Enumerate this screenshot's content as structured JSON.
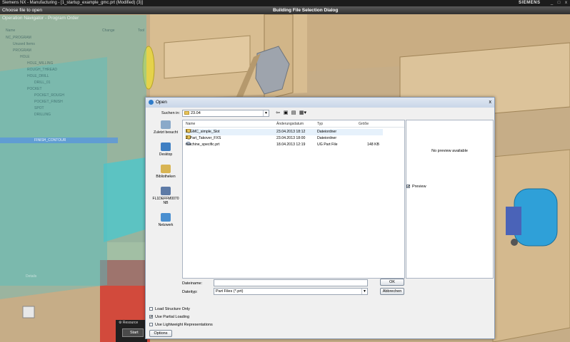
{
  "window": {
    "title": "Siemens NX - Manufacturing - [1_startup_example_gmc.prt (Modified)   (3)]",
    "brand": "SIEMENS",
    "controls": [
      "_",
      "□",
      "x"
    ]
  },
  "command_bar": {
    "prompt": "Choose file to open",
    "dialog_name": "Building File Selection Dialog"
  },
  "navigator": {
    "title": "Operation Navigator - Program Order",
    "columns": [
      "Name",
      "Change",
      "Tool"
    ],
    "rows": [
      "NC_PROGRAM",
      "Unused Items",
      "PROGRAM",
      "HOLE",
      "HOLE_MILLING",
      "ROUGH_THREAD",
      "HOLE_DRILL",
      "DRILL_01",
      "POCKET",
      "POCKET_ROUGH",
      "POCKET_FINISH",
      "SPOT",
      "DRILLING",
      "FINISH_CONTOUR"
    ],
    "selected_index": 13,
    "footer": "Details"
  },
  "resource_bar": {
    "label": "Resource",
    "start": "Start"
  },
  "dialog": {
    "title": "Open",
    "close": "x",
    "look_in_label": "Suchen in:",
    "look_in_value": "23.04",
    "places": [
      {
        "label": "Zuletzt besucht",
        "icon": "recent-places-icon",
        "color": "#8aa9c9"
      },
      {
        "label": "Desktop",
        "icon": "desktop-icon",
        "color": "#3f7fc3"
      },
      {
        "label": "Bibliotheken",
        "icon": "libraries-icon",
        "color": "#d8b453"
      },
      {
        "label": "FL1DEFFM0070 NB",
        "icon": "computer-icon",
        "color": "#5d7aa6"
      },
      {
        "label": "Netzwerk",
        "icon": "network-icon",
        "color": "#4a8fd0"
      }
    ],
    "columns": [
      "Name",
      "Änderungsdatum",
      "Typ",
      "Größe"
    ],
    "files": [
      {
        "name": "1_GMC_simple_Slot",
        "date": "23.04.2013 18:12",
        "type": "Dateiordner",
        "size": "",
        "kind": "folder"
      },
      {
        "name": "2_Part_Takover_FXS",
        "date": "23.04.2013 18:00",
        "type": "Dateiordner",
        "size": "",
        "kind": "folder"
      },
      {
        "name": "machine_specific.prt",
        "date": "18.04.2013 12:19",
        "type": "UG Part File",
        "size": "148 KB",
        "kind": "part"
      }
    ],
    "preview_text": "No preview available",
    "preview_check": "Preview",
    "filename_label": "Dateiname:",
    "filename_value": "",
    "filetype_label": "Dateityp:",
    "filetype_value": "Part Files (*.prt)",
    "ok": "OK",
    "cancel": "Abbrechen",
    "options": [
      {
        "label": "Load Structure Only",
        "checked": false
      },
      {
        "label": "Use Partial Loading",
        "checked": true
      },
      {
        "label": "Use Lightweight Representations",
        "checked": false
      }
    ],
    "options_button": "Options"
  }
}
